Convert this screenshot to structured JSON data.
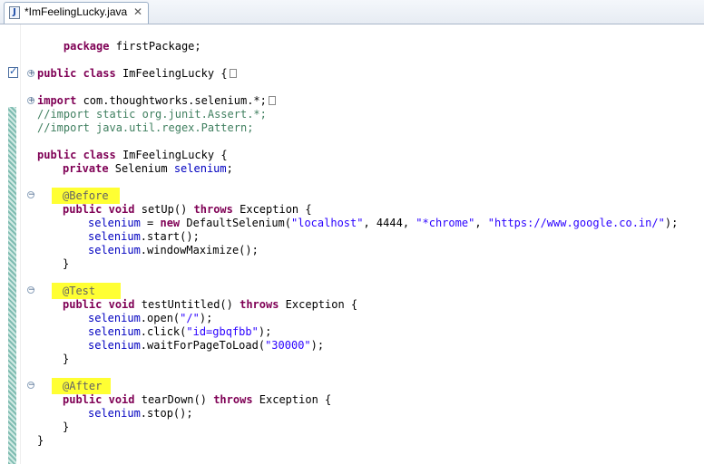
{
  "tab": {
    "title": "*ImFeelingLucky.java",
    "close": "✕",
    "icon": "J"
  },
  "code": {
    "l1": "package firstPackage;",
    "l2": "public class ImFeelingLucky {",
    "l3": "import com.thoughtworks.selenium.*;",
    "l4": "//import static org.junit.Assert.*;",
    "l5": "//import java.util.regex.Pattern;",
    "l6": "public class ImFeelingLucky {",
    "l7": "private Selenium selenium;",
    "ann_before": "@Before",
    "l9": "public void setUp() throws Exception {",
    "l10a": "selenium",
    "l10b": " = new DefaultSelenium(",
    "l10c": "\"localhost\"",
    "l10d": ", 4444, ",
    "l10e": "\"*chrome\"",
    "l10f": ", ",
    "l10g": "\"https://www.google.co.in/\"",
    "l10h": ");",
    "l11": "selenium.start();",
    "l12": "selenium.windowMaximize();",
    "close_brace": "}",
    "ann_test": "@Test",
    "l15": "public void testUntitled() throws Exception {",
    "l16a": "selenium.open(",
    "l16b": "\"/\"",
    "l16c": ");",
    "l17a": "selenium.click(",
    "l17b": "\"id=gbqfbb\"",
    "l17c": ");",
    "l18a": "selenium.waitForPageToLoad(",
    "l18b": "\"30000\"",
    "l18c": ");",
    "ann_after": "@After",
    "l21": "public void tearDown() throws Exception {",
    "l22": "selenium.stop();"
  }
}
